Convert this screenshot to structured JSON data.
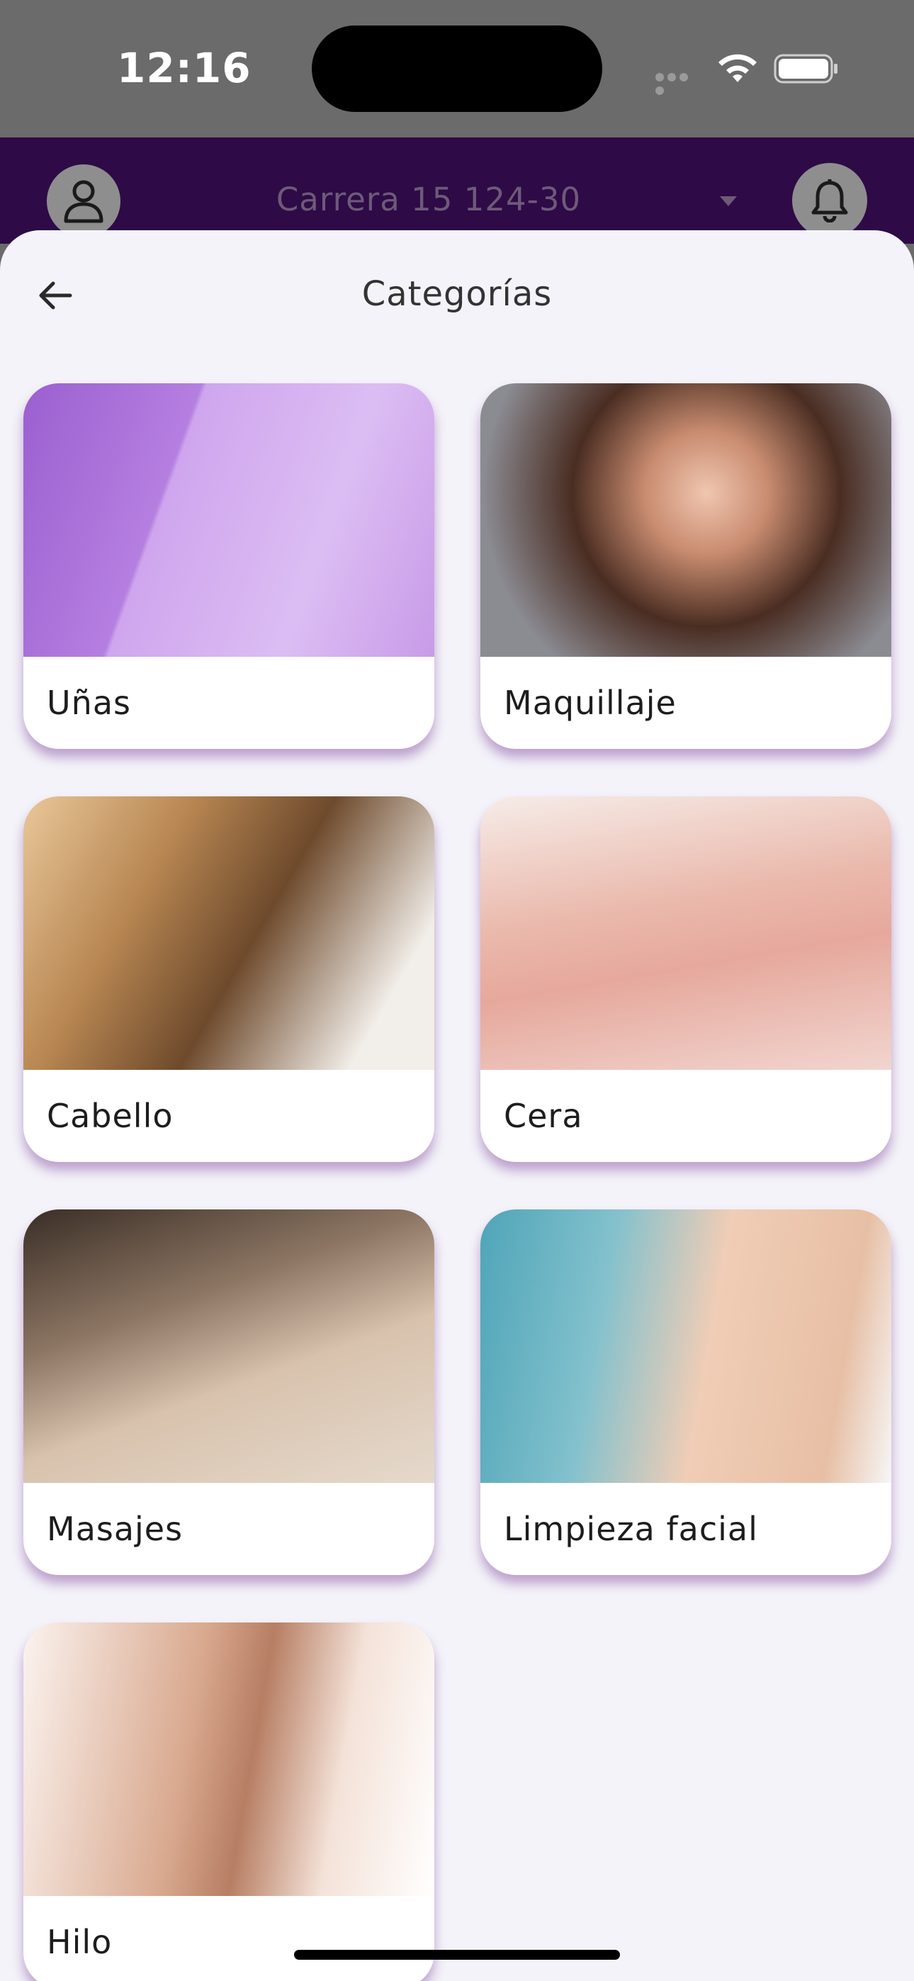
{
  "status_bar": {
    "time": "12:16"
  },
  "header": {
    "address": "Carrera 15 124-30",
    "avatar_icon": "user-icon",
    "bell_icon": "bell-icon",
    "caret_icon": "caret-down-icon"
  },
  "sheet": {
    "title": "Categorías",
    "back_icon": "arrow-left-icon"
  },
  "categories": [
    {
      "label": "Uñas"
    },
    {
      "label": "Maquillaje"
    },
    {
      "label": "Cabello"
    },
    {
      "label": "Cera"
    },
    {
      "label": "Masajes"
    },
    {
      "label": "Limpieza facial"
    },
    {
      "label": "Hilo"
    }
  ],
  "colors": {
    "header_bg": "#2e0a47",
    "sheet_bg": "#f4f3f9",
    "card_shadow": "#7a3c96"
  }
}
